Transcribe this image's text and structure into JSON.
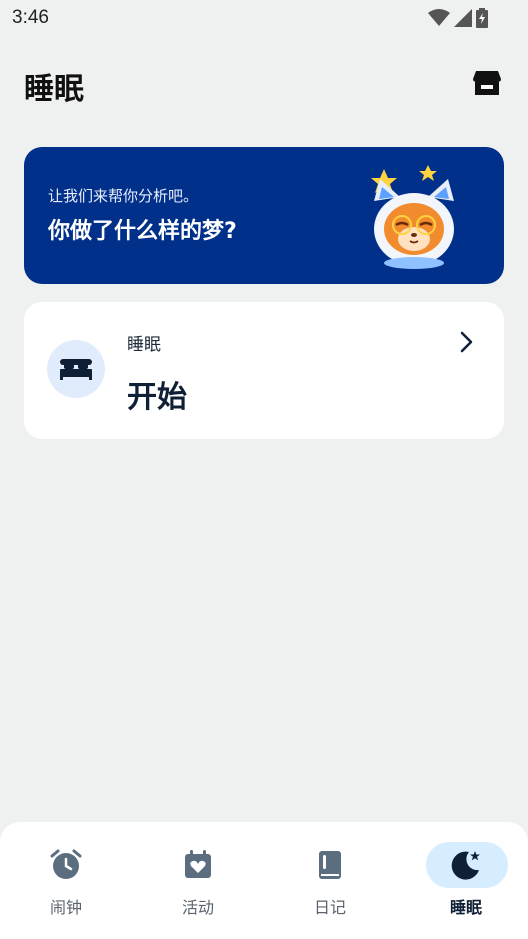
{
  "status_bar": {
    "time": "3:46"
  },
  "header": {
    "title": "睡眠",
    "store_icon": "store-icon"
  },
  "dream_card": {
    "subtitle": "让我们来帮你分析吧。",
    "title": "你做了什么样的梦?",
    "background": "#00308a"
  },
  "sleep_card": {
    "label": "睡眠",
    "action": "开始",
    "icon": "bed-icon"
  },
  "bottom_nav": {
    "items": [
      {
        "label": "闹钟",
        "icon": "alarm-clock-icon",
        "active": false
      },
      {
        "label": "活动",
        "icon": "calendar-heart-icon",
        "active": false
      },
      {
        "label": "日记",
        "icon": "book-icon",
        "active": false
      },
      {
        "label": "睡眠",
        "icon": "moon-star-icon",
        "active": true
      }
    ],
    "active_color": "#d6ecff"
  }
}
